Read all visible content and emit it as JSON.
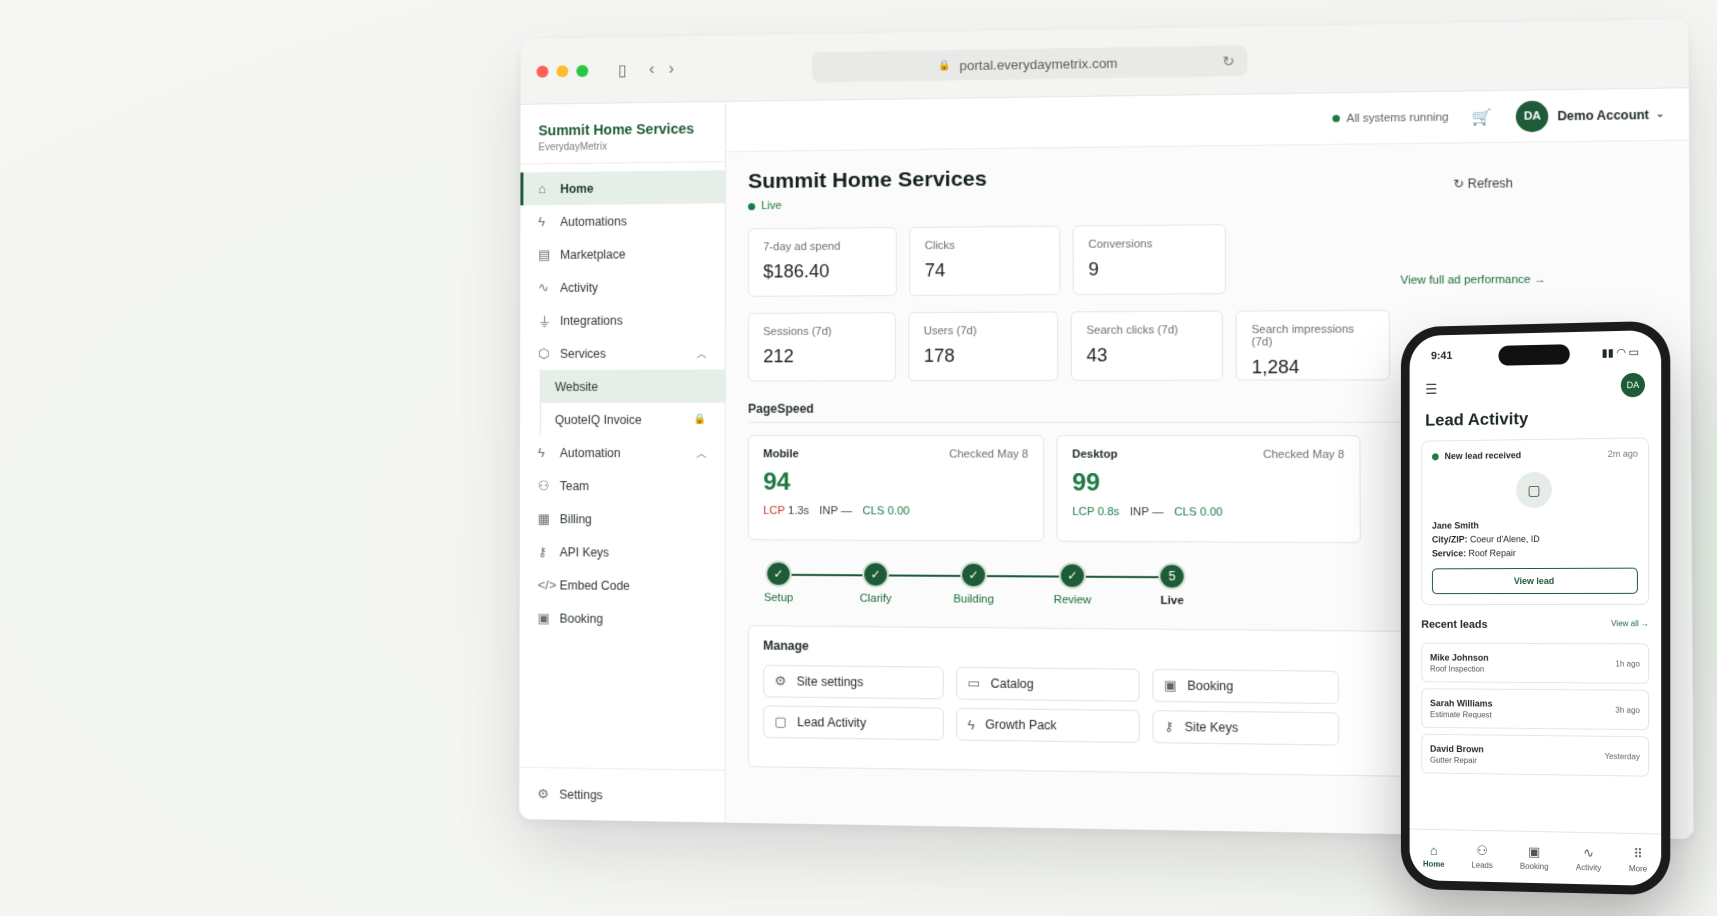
{
  "browser": {
    "url": "portal.everydaymetrix.com"
  },
  "sidebar": {
    "brand_title": "Summit Home Services",
    "brand_sub": "EverydayMetrix",
    "items": [
      {
        "label": "Home",
        "icon": "home-icon"
      },
      {
        "label": "Automations",
        "icon": "bolt-icon"
      },
      {
        "label": "Marketplace",
        "icon": "store-icon"
      },
      {
        "label": "Activity",
        "icon": "activity-icon"
      },
      {
        "label": "Integrations",
        "icon": "plug-icon"
      },
      {
        "label": "Services",
        "icon": "box-icon"
      },
      {
        "label": "Website"
      },
      {
        "label": "QuoteIQ Invoice"
      },
      {
        "label": "Automation",
        "icon": "bolt-icon"
      },
      {
        "label": "Team",
        "icon": "users-icon"
      },
      {
        "label": "Billing",
        "icon": "receipt-icon"
      },
      {
        "label": "API Keys",
        "icon": "key-icon"
      },
      {
        "label": "Embed Code",
        "icon": "code-icon"
      },
      {
        "label": "Booking",
        "icon": "calendar-icon"
      }
    ],
    "settings": "Settings"
  },
  "topbar": {
    "status": "All systems running",
    "avatar": "DA",
    "account": "Demo Account"
  },
  "page": {
    "title": "Summit Home Services",
    "live": "Live",
    "refresh": "Refresh",
    "perf_link": "View full ad performance →"
  },
  "metrics_row1": [
    {
      "label": "7-day ad spend",
      "value": "$186.40"
    },
    {
      "label": "Clicks",
      "value": "74"
    },
    {
      "label": "Conversions",
      "value": "9"
    }
  ],
  "metrics_row2": [
    {
      "label": "Sessions (7d)",
      "value": "212"
    },
    {
      "label": "Users (7d)",
      "value": "178"
    },
    {
      "label": "Search clicks (7d)",
      "value": "43"
    },
    {
      "label": "Search impressions (7d)",
      "value": "1,284"
    }
  ],
  "pagespeed": {
    "label": "PageSpeed",
    "mobile": {
      "name": "Mobile",
      "checked": "Checked May 8",
      "score": "94",
      "lcp": "LCP",
      "lcp_val": "1.3s",
      "inp": "INP —",
      "cls": "CLS 0.00"
    },
    "desktop": {
      "name": "Desktop",
      "checked": "Checked May 8",
      "score": "99",
      "lcp": "LCP 0.8s",
      "inp": "INP —",
      "cls": "CLS 0.00"
    }
  },
  "steps": [
    "Setup",
    "Clarify",
    "Building",
    "Review",
    "Live"
  ],
  "step_current_number": "5",
  "manage": {
    "title": "Manage",
    "buttons": [
      {
        "label": "Site settings",
        "icon": "gear-icon"
      },
      {
        "label": "Catalog",
        "icon": "catalog-icon"
      },
      {
        "label": "Booking",
        "icon": "calendar-icon"
      },
      {
        "label": "Lead Activity",
        "icon": "message-icon"
      },
      {
        "label": "Growth Pack",
        "icon": "bolt-icon"
      },
      {
        "label": "Site Keys",
        "icon": "key-icon"
      }
    ]
  },
  "phone": {
    "time": "9:41",
    "avatar": "DA",
    "title": "Lead Activity",
    "new_lead": "New lead received",
    "new_lead_time": "2m ago",
    "lead_name": "Jane Smith",
    "city_label": "City/ZIP:",
    "city_value": "Coeur d'Alene, ID",
    "service_label": "Service:",
    "service_value": "Roof Repair",
    "view_lead": "View lead",
    "recent_title": "Recent leads",
    "view_all": "View all →",
    "recent": [
      {
        "name": "Mike Johnson",
        "service": "Roof Inspection",
        "time": "1h ago"
      },
      {
        "name": "Sarah Williams",
        "service": "Estimate Request",
        "time": "3h ago"
      },
      {
        "name": "David Brown",
        "service": "Gutter Repair",
        "time": "Yesterday"
      }
    ],
    "tabs": [
      "Home",
      "Leads",
      "Booking",
      "Activity",
      "More"
    ]
  },
  "colors": {
    "brand": "#1e5b37",
    "accent_green": "#1e7a44",
    "warn_red": "#c0392b"
  }
}
